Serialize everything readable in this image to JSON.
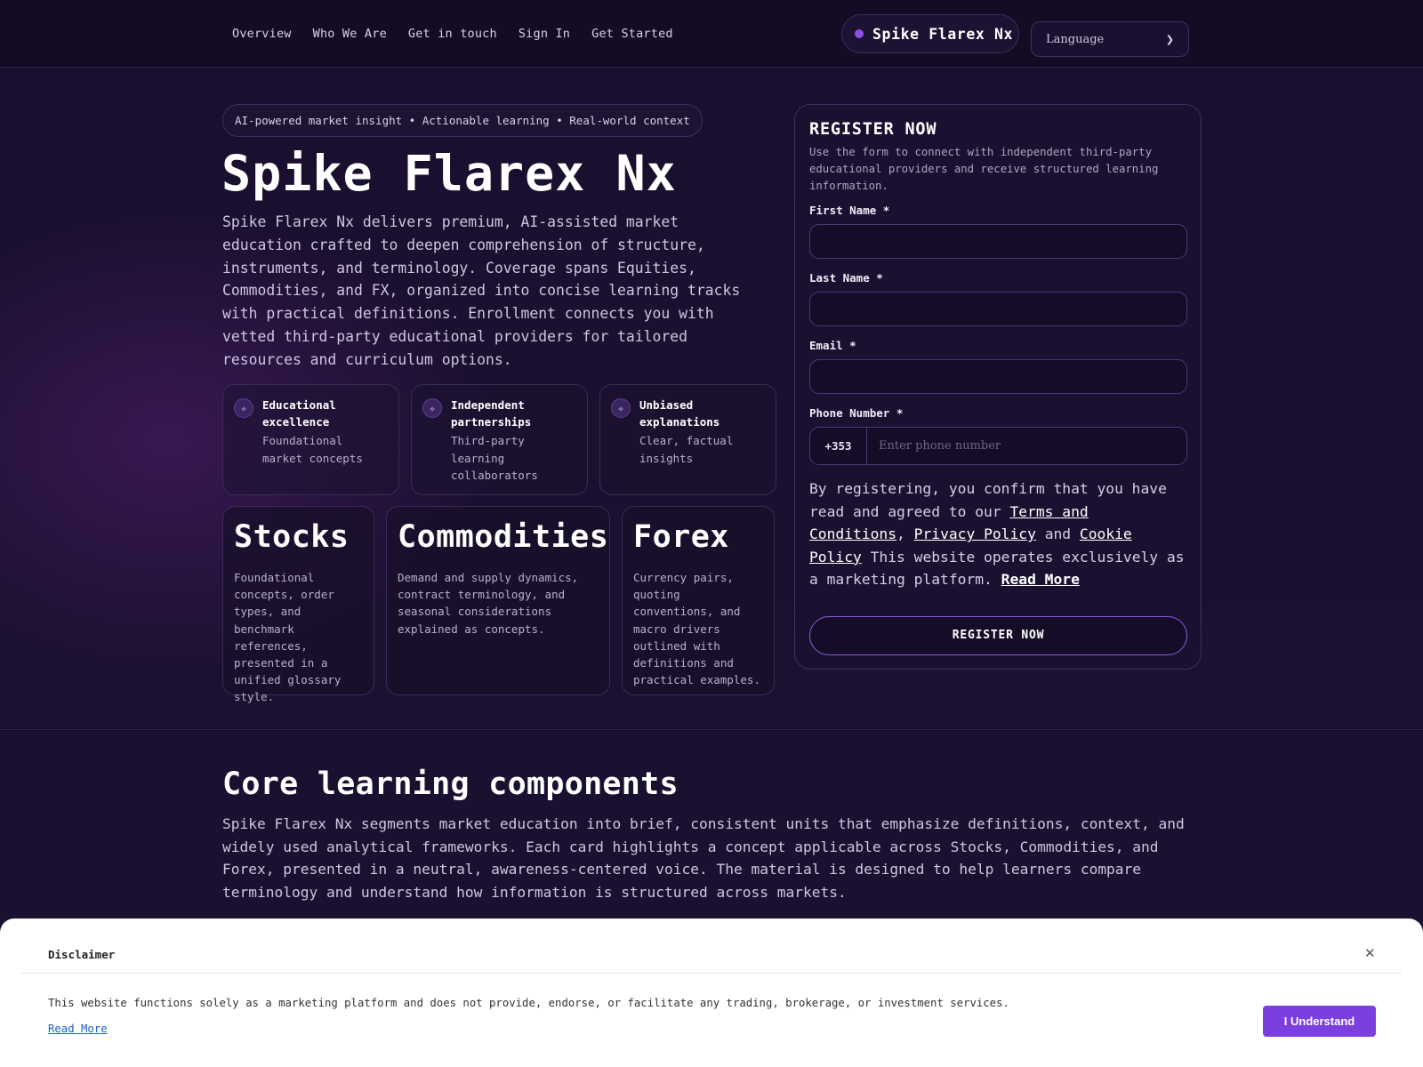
{
  "nav": {
    "links": [
      "Overview",
      "Who We Are",
      "Get in touch",
      "Sign In",
      "Get Started"
    ],
    "brand": "Spike Flarex Nx",
    "language_label": "Language"
  },
  "hero": {
    "tagline": "AI-powered market insight • Actionable learning • Real-world context",
    "title": "Spike Flarex Nx",
    "description": "Spike Flarex Nx delivers premium, AI-assisted market education crafted to deepen comprehension of structure, instruments, and terminology. Coverage spans Equities, Commodities, and FX, organized into concise learning tracks with practical definitions. Enrollment connects you with vetted third-party educational providers for tailored resources and curriculum options.",
    "features": [
      {
        "title": "Educational excellence",
        "sub": "Foundational market concepts",
        "icon": "sparkle-icon"
      },
      {
        "title": "Independent partnerships",
        "sub": "Third-party learning collaborators",
        "icon": "sparkle-icon"
      },
      {
        "title": "Unbiased explanations",
        "sub": "Clear, factual insights",
        "icon": "sparkle-icon"
      }
    ],
    "markets": [
      {
        "title": "Stocks",
        "desc": "Foundational concepts, order types, and benchmark references, presented in a unified glossary style."
      },
      {
        "title": "Commodities",
        "desc": "Demand and supply dynamics, contract terminology, and seasonal considerations explained as concepts."
      },
      {
        "title": "Forex",
        "desc": "Currency pairs, quoting conventions, and macro drivers outlined with definitions and practical examples."
      }
    ]
  },
  "form": {
    "title": "REGISTER NOW",
    "description": "Use the form to connect with independent third-party educational providers and receive structured learning information.",
    "first_name_label": "First Name *",
    "last_name_label": "Last Name *",
    "email_label": "Email *",
    "phone_label": "Phone Number *",
    "phone_code": "+353",
    "phone_placeholder": "Enter phone number",
    "consent_prefix": "By registering, you confirm that you have read and agreed to our ",
    "terms_link": "Terms and Conditions",
    "comma": ",",
    "privacy_link": "Privacy Policy",
    "and_text": " and ",
    "cookie_link": "Cookie Policy",
    "consent_suffix": " This website operates exclusively as a marketing platform. ",
    "read_more": "Read More",
    "submit_label": "REGISTER NOW"
  },
  "core": {
    "title": "Core learning components",
    "description": "Spike Flarex Nx segments market education into brief, consistent units that emphasize definitions, context, and widely used analytical frameworks. Each card highlights a concept applicable across Stocks, Commodities, and Forex, presented in a neutral, awareness-centered voice. The material is designed to help learners compare terminology and understand how information is structured across markets."
  },
  "disclaimer": {
    "title": "Disclaimer",
    "text": "This website functions solely as a marketing platform and does not provide, endorse, or facilitate any trading, brokerage, or investment services.",
    "read_more": "Read More",
    "button": "I Understand",
    "close_icon": "close-icon"
  },
  "colors": {
    "accent": "#7b3fe0",
    "background": "#150d26",
    "brand_dot": "#8b4ee8"
  }
}
